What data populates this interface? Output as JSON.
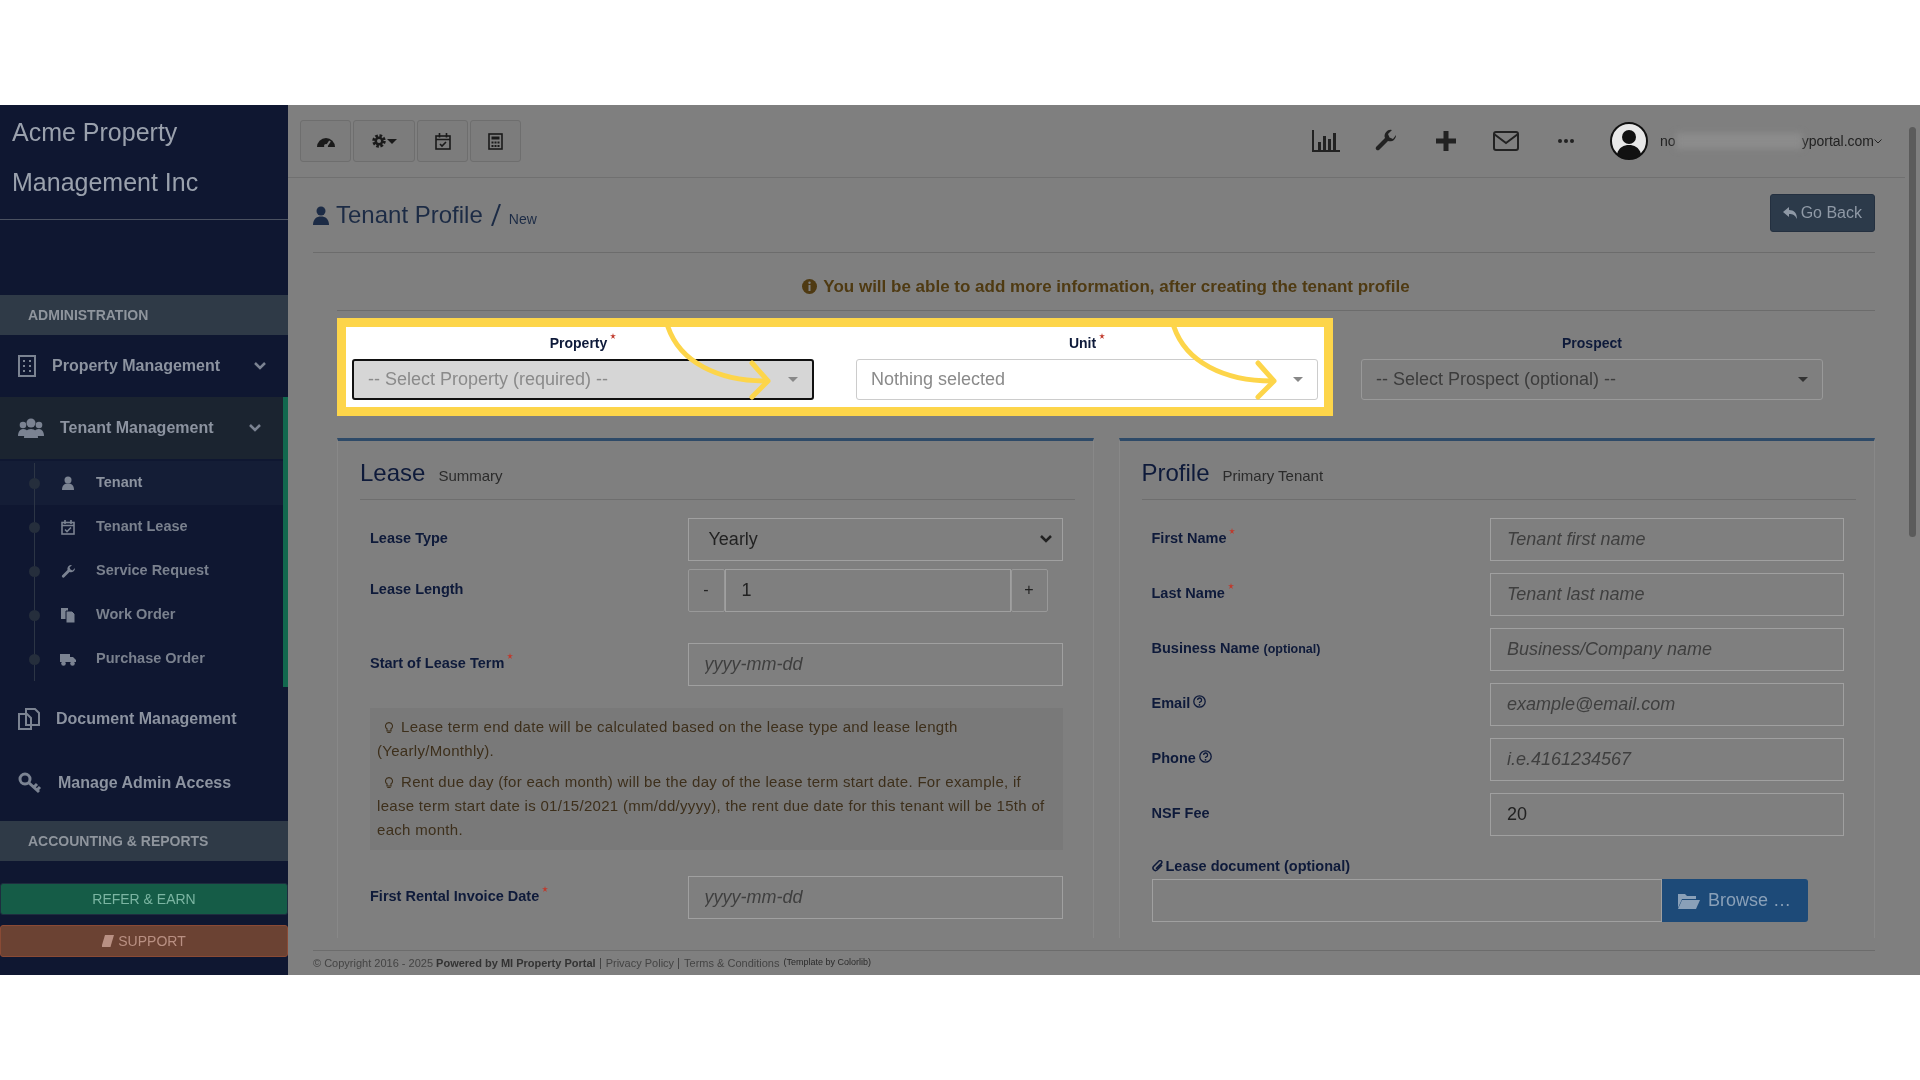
{
  "sidebar": {
    "brand": "Acme Property Management Inc",
    "items": [
      {
        "kind": "header",
        "label": "ADMINISTRATION"
      },
      {
        "kind": "group",
        "label": "Property Management",
        "expanded": false
      },
      {
        "kind": "group",
        "label": "Tenant Management",
        "expanded": true,
        "children": [
          {
            "label": "Tenant",
            "selected": true
          },
          {
            "label": "Tenant Lease",
            "selected": false
          },
          {
            "label": "Service Request",
            "selected": false
          },
          {
            "label": "Work Order",
            "selected": false
          },
          {
            "label": "Purchase Order",
            "selected": false
          }
        ]
      },
      {
        "kind": "link",
        "label": "Document Management"
      },
      {
        "kind": "link",
        "label": "Manage Admin Access"
      },
      {
        "kind": "header",
        "label": "ACCOUNTING & REPORTS"
      }
    ],
    "buttons": [
      {
        "kind": "refer",
        "label": "REFER & EARN"
      },
      {
        "kind": "support",
        "label": "SUPPORT"
      }
    ]
  },
  "user": {
    "email_start": "no",
    "email_end": "yportal.com"
  },
  "page": {
    "title": "Tenant Profile",
    "subtitle": "New",
    "back_button": "Go Back",
    "notice": "You will be able to add more information, after creating the tenant profile"
  },
  "selectors": [
    {
      "label": "Property",
      "required": true,
      "placeholder": "-- Select Property (required) --",
      "highlighted": true,
      "focused": true
    },
    {
      "label": "Unit",
      "required": true,
      "placeholder": "Nothing selected",
      "highlighted": true,
      "focused": false
    },
    {
      "label": "Prospect",
      "required": false,
      "placeholder": "-- Select Prospect (optional) --",
      "highlighted": false,
      "focused": false
    }
  ],
  "lease": {
    "title": "Lease",
    "subtitle": "Summary",
    "fields": [
      {
        "kind": "select",
        "label": "Lease Type",
        "value": "Yearly"
      },
      {
        "kind": "stepper",
        "label": "Lease Length",
        "value": "1",
        "minus": "-",
        "plus": "+"
      },
      {
        "kind": "input",
        "label": "Start of Lease Term",
        "required": true,
        "placeholder": "yyyy-mm-dd"
      },
      {
        "kind": "hints",
        "items": [
          "Lease term end date will be calculated based on the lease type and lease length (Yearly/Monthly).",
          "Rent due day (for each month) will be the day of the lease term start date. For example, if lease term start date is 01/15/2021 (mm/dd/yyyy), the rent due date for this tenant will be 15th of each month."
        ]
      },
      {
        "kind": "input",
        "label": "First Rental Invoice Date",
        "required": true,
        "placeholder": "yyyy-mm-dd"
      }
    ]
  },
  "profile": {
    "title": "Profile",
    "subtitle": "Primary Tenant",
    "fields": [
      {
        "label": "First Name",
        "required": true,
        "placeholder": "Tenant first name"
      },
      {
        "label": "Last Name",
        "required": true,
        "placeholder": "Tenant last name"
      },
      {
        "label": "Business Name",
        "note": "(optional)",
        "placeholder": "Business/Company name"
      },
      {
        "label": "Email",
        "help": true,
        "placeholder": "example@email.com"
      },
      {
        "label": "Phone",
        "help": true,
        "placeholder": "i.e.4161234567"
      },
      {
        "label": "NSF Fee",
        "value": "20"
      }
    ],
    "upload": {
      "label": "Lease document (optional)",
      "button": "Browse …"
    }
  },
  "footer": {
    "copyright": "© Copyright 2016 - 2025 **Powered by MI Property Portal**",
    "links": [
      "Privacy Policy",
      "Terms & Conditions"
    ],
    "credit": "(Template by Colorlib)"
  }
}
